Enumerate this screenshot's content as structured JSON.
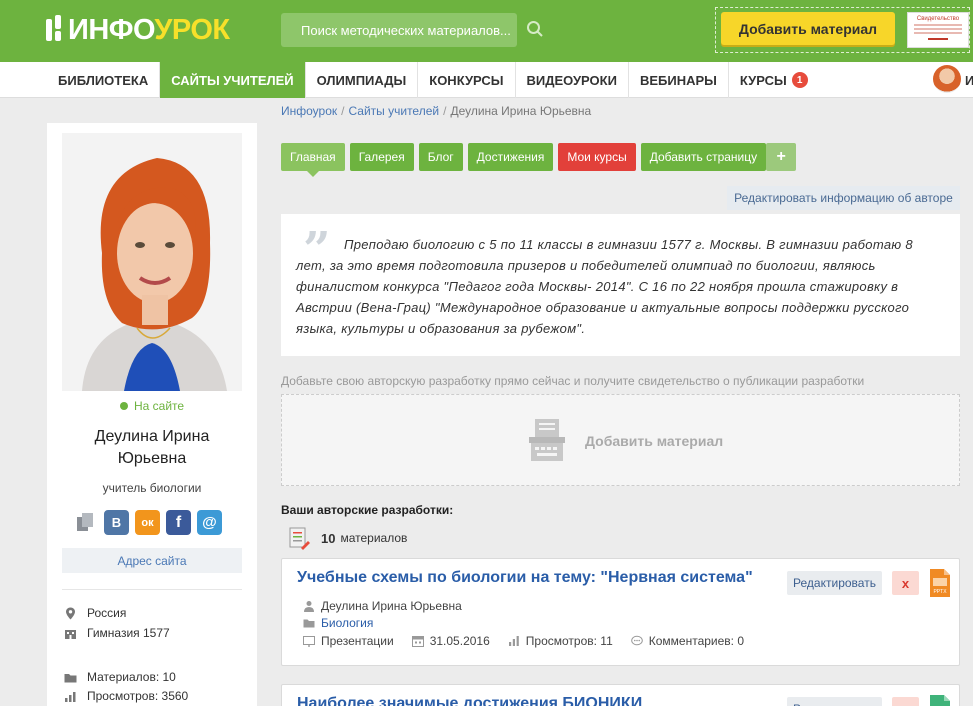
{
  "header": {
    "logo_left": "ИНФО",
    "logo_right": "УРОК",
    "search_placeholder": "Поиск методических материалов...",
    "add_material_label": "Добавить материал",
    "certificate_label": "Свидетельство"
  },
  "nav": {
    "items": [
      "БИБЛИОТЕКА",
      "САЙТЫ УЧИТЕЛЕЙ",
      "ОЛИМПИАДЫ",
      "КОНКУРСЫ",
      "ВИДЕОУРОКИ",
      "ВЕБИНАРЫ",
      "КУРСЫ"
    ],
    "courses_badge": "1",
    "user_initial": "И"
  },
  "sidebar": {
    "status": "На сайте",
    "name": "Деулина Ирина Юрьевна",
    "role": "учитель биологии",
    "site_link": "Адрес сайта",
    "country": "Россия",
    "school": "Гимназия 1577",
    "materials": "Материалов: 10",
    "views": "Просмотров: 3560",
    "social": {
      "vk": "В",
      "ok": "ок",
      "fb": "f",
      "mail": "@"
    }
  },
  "breadcrumb": {
    "home": "Инфоурок",
    "section": "Сайты учителей",
    "current": "Деулина Ирина Юрьевна"
  },
  "tabs": {
    "main": "Главная",
    "gallery": "Галерея",
    "blog": "Блог",
    "achievements": "Достижения",
    "my_courses": "Мои курсы",
    "add_page": "Добавить страницу",
    "plus": "+"
  },
  "edit_author_label": "Редактировать информацию об авторе",
  "about": "Преподаю биологию с 5 по 11 классы в гимназии 1577 г. Москвы. В гимназии работаю 8 лет, за это время подготовила призеров и победителей олимпиад по биологии, являюсь финалистом конкурса \"Педагог года Москвы- 2014\". С 16 по 22 ноября прошла стажировку в Австрии (Вена-Грац) \"Международное образование и актуальные вопросы поддержки русского языка, культуры и образования за рубежом\".",
  "promo_text": "Добавьте свою авторскую разработку прямо сейчас и получите свидетельство о публикации разработки",
  "dropzone_label": "Добавить материал",
  "works": {
    "title": "Ваши авторские разработки:",
    "count": "10",
    "count_label": "материалов"
  },
  "cards": [
    {
      "title": "Учебные схемы по биологии на тему: \"Нервная система\"",
      "edit": "Редактировать",
      "delete": "x",
      "file_type": "PPTX",
      "author": "Деулина Ирина Юрьевна",
      "subject": "Биология",
      "type": "Презентации",
      "date": "31.05.2016",
      "views": "Просмотров: 11",
      "comments": "Комментариев: 0"
    },
    {
      "title": "Наиболее значимые достижения БИОНИКИ",
      "edit": "Редактировать",
      "delete": "x"
    }
  ],
  "colors": {
    "brand_green": "#6db33f",
    "accent_yellow": "#f7d629",
    "danger": "#e2403a",
    "link": "#2a5da8"
  }
}
